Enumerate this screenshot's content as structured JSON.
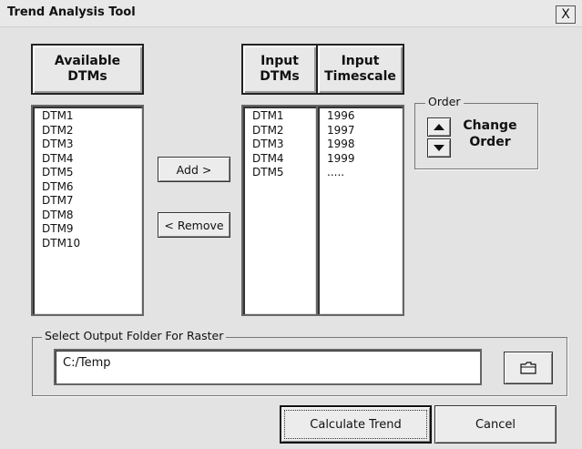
{
  "window": {
    "title": "Trend Analysis Tool",
    "close_label": "X"
  },
  "available": {
    "header": "Available\nDTMs",
    "items": [
      "DTM1",
      "DTM2",
      "DTM3",
      "DTM4",
      "DTM5",
      "DTM6",
      "DTM7",
      "DTM8",
      "DTM9",
      "DTM10"
    ]
  },
  "buttons": {
    "add": "Add >",
    "remove": "< Remove",
    "calculate": "Calculate Trend",
    "cancel": "Cancel"
  },
  "input": {
    "dtms_header": "Input\nDTMs",
    "timescale_header": "Input\nTimescale",
    "dtms": [
      "DTM1",
      "DTM2",
      "DTM3",
      "DTM4",
      "DTM5"
    ],
    "timescale": [
      "1996",
      "1997",
      "1998",
      "1999",
      "....."
    ]
  },
  "order": {
    "group_label": "Order",
    "change_label": "Change\nOrder"
  },
  "output": {
    "group_label": "Select Output Folder For Raster",
    "folder_value": "C:/Temp"
  },
  "icons": {
    "close": "close-icon",
    "up": "arrow-up-icon",
    "down": "arrow-down-icon",
    "folder": "folder-icon"
  }
}
